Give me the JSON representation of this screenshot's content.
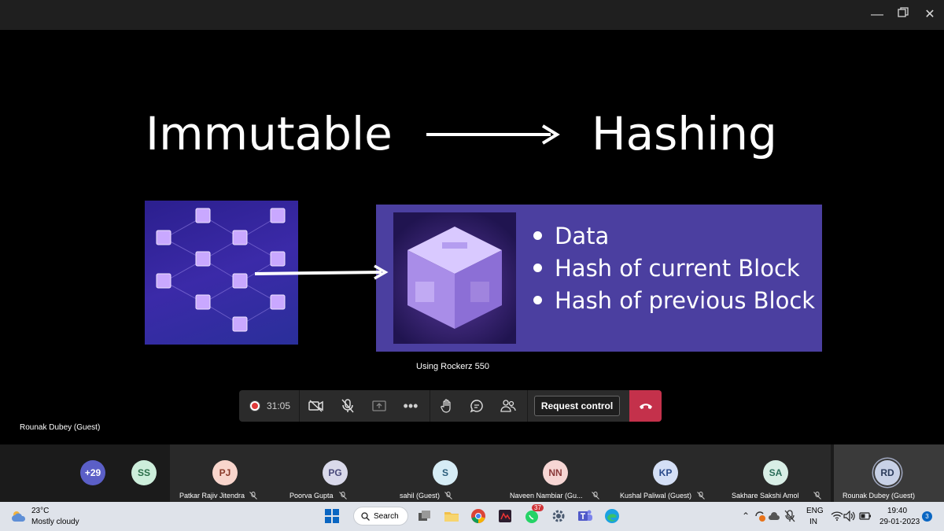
{
  "slide": {
    "title_left": "Immutable",
    "title_right": "Hashing",
    "bullets": [
      "Data",
      "Hash of current Block",
      "Hash of previous Block"
    ],
    "caption": "Using Rockerz 550",
    "panel_color": "#4b3fa0"
  },
  "presenter": {
    "name": "Rounak Dubey (Guest)"
  },
  "meeting_bar": {
    "timer": "31:05",
    "request_control_label": "Request control",
    "hangup_color": "#c4314b",
    "icons": [
      "record-icon",
      "camera-off-icon",
      "mic-off-icon",
      "share-icon",
      "more-icon",
      "raise-hand-icon",
      "chat-icon",
      "participants-icon",
      "hangup-icon"
    ]
  },
  "participants": {
    "overflow_count": "+29",
    "small_tile": {
      "initials": "SS",
      "color": "#cdeedb"
    },
    "tiles": [
      {
        "initials": "PJ",
        "name": "Patkar Rajiv Jitendra",
        "color": "#f8d5cc"
      },
      {
        "initials": "PG",
        "name": "Poorva Gupta",
        "color": "#d9d9ea"
      },
      {
        "initials": "S",
        "name": "sahil (Guest)",
        "color": "#d6ecf5"
      },
      {
        "initials": "NN",
        "name": "Naveen Nambiar (Gu...",
        "color": "#f6d6d4"
      },
      {
        "initials": "KP",
        "name": "Kushal Paliwal (Guest)",
        "color": "#d4dff5"
      },
      {
        "initials": "SA",
        "name": "Sakhare Sakshi Amol",
        "color": "#d8eee6"
      },
      {
        "initials": "RD",
        "name": "Rounak Dubey (Guest)",
        "color": "#c8d1e6"
      }
    ]
  },
  "taskbar": {
    "weather_temp": "23°C",
    "weather_desc": "Mostly cloudy",
    "search_label": "Search",
    "whatsapp_badge": "37",
    "language": "ENG",
    "region": "IN",
    "time": "19:40",
    "date": "29-01-2023",
    "notification_count": "3"
  }
}
